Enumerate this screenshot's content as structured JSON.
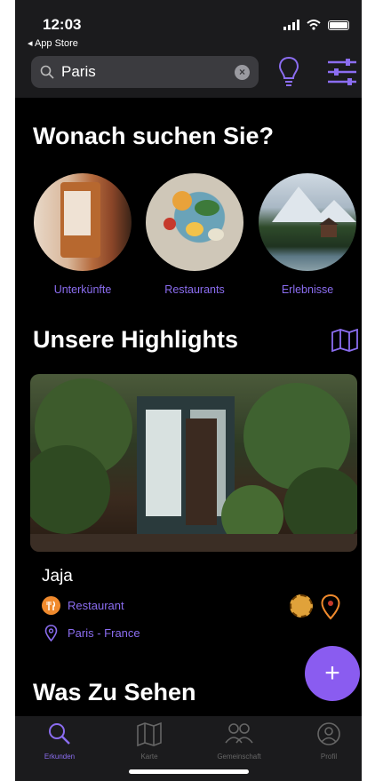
{
  "status": {
    "time": "12:03",
    "back_label": "◂ App Store"
  },
  "search": {
    "value": "Paris"
  },
  "headings": {
    "what": "Wonach suchen Sie?",
    "highlights": "Unsere Highlights",
    "see": "Was Zu Sehen"
  },
  "categories": [
    {
      "label": "Unterkünfte"
    },
    {
      "label": "Restaurants"
    },
    {
      "label": "Erlebnisse"
    }
  ],
  "highlight": {
    "name": "Jaja",
    "type": "Restaurant",
    "location": "Paris - France"
  },
  "fab": {
    "label": "+"
  },
  "tabs": [
    {
      "label": "Erkunden",
      "icon": "search-icon",
      "active": true
    },
    {
      "label": "Karte",
      "icon": "map-icon"
    },
    {
      "label": "Gemeinschaft",
      "icon": "community-icon"
    },
    {
      "label": "Profil",
      "icon": "profile-icon"
    }
  ],
  "colors": {
    "accent": "#8b6df0",
    "fab": "#8a5cf0",
    "badge_orange": "#f08a2d"
  }
}
